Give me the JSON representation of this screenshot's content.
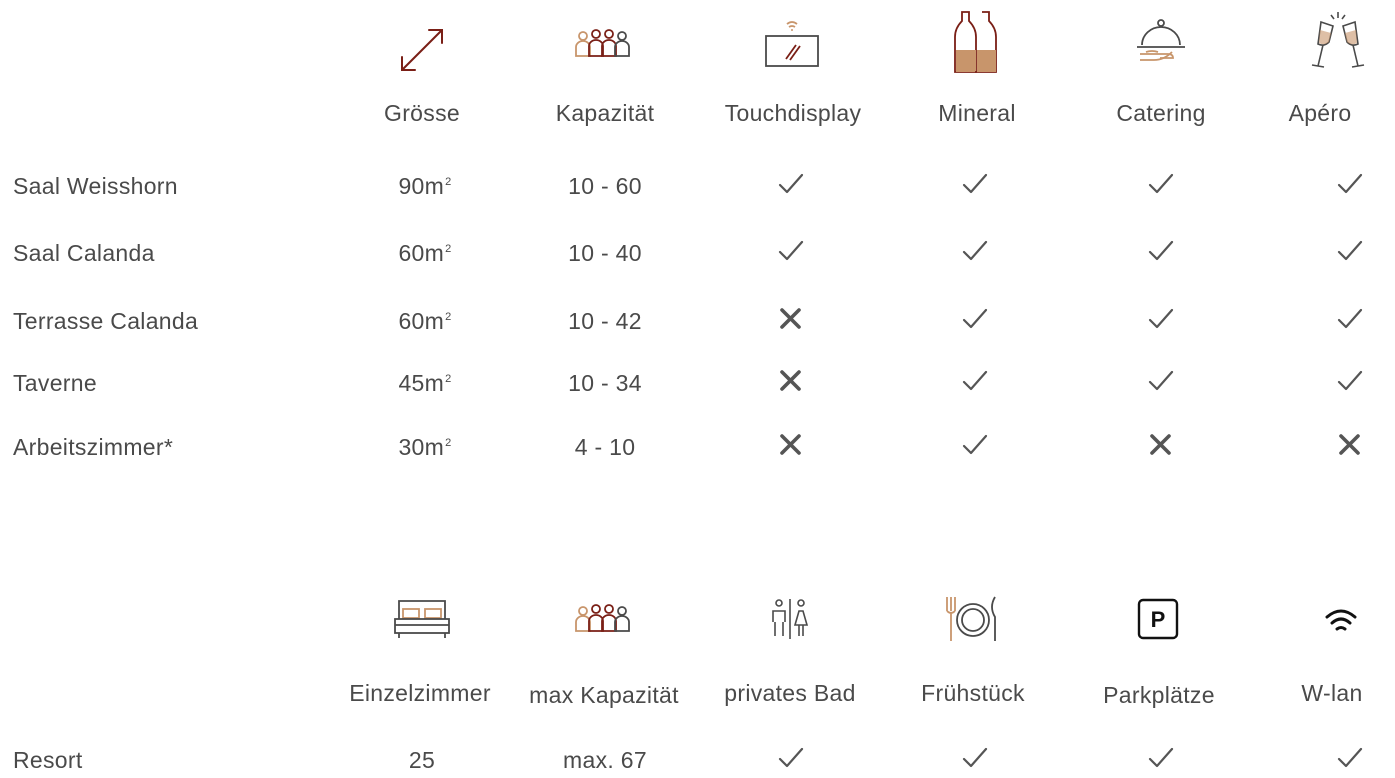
{
  "colors": {
    "text": "#4a4a4a",
    "brown": "#7a1f16",
    "tan": "#c8956b",
    "check": "#555555"
  },
  "rooms_table": {
    "headers": [
      {
        "label": "Grösse",
        "icon": "resize-diagonal-icon"
      },
      {
        "label": "Kapazität",
        "icon": "people-group-icon"
      },
      {
        "label": "Touchdisplay",
        "icon": "touch-display-icon"
      },
      {
        "label": "Mineral",
        "icon": "mineral-bottles-icon"
      },
      {
        "label": "Catering",
        "icon": "catering-cloche-icon"
      },
      {
        "label": "Apéro",
        "icon": "champagne-glasses-icon"
      }
    ],
    "rows": [
      {
        "name": "Saal Weisshorn",
        "size": "90m",
        "size_sup": "2",
        "capacity": "10 - 60",
        "touchdisplay": true,
        "mineral": true,
        "catering": true,
        "apero": true
      },
      {
        "name": "Saal Calanda",
        "size": "60m",
        "size_sup": "2",
        "capacity": "10 - 40",
        "touchdisplay": true,
        "mineral": true,
        "catering": true,
        "apero": true
      },
      {
        "name": "Terrasse Calanda",
        "size": "60m",
        "size_sup": "2",
        "capacity": "10 - 42",
        "touchdisplay": false,
        "mineral": true,
        "catering": true,
        "apero": true
      },
      {
        "name": "Taverne",
        "size": "45m",
        "size_sup": "2",
        "capacity": "10 - 34",
        "touchdisplay": false,
        "mineral": true,
        "catering": true,
        "apero": true
      },
      {
        "name": "Arbeitszimmer*",
        "size": "30m",
        "size_sup": "2",
        "capacity": "4 - 10",
        "touchdisplay": false,
        "mineral": true,
        "catering": false,
        "apero": false
      }
    ]
  },
  "resort_table": {
    "headers": [
      {
        "label": "Einzelzimmer",
        "icon": "bed-icon"
      },
      {
        "label": "max Kapazität",
        "icon": "people-group-icon"
      },
      {
        "label": "privates Bad",
        "icon": "restroom-icon"
      },
      {
        "label": "Frühstück",
        "icon": "plate-cutlery-icon"
      },
      {
        "label": "Parkplätze",
        "icon": "parking-icon"
      },
      {
        "label": "W-lan",
        "icon": "wifi-icon"
      }
    ],
    "rows": [
      {
        "name": "Resort",
        "rooms": "25",
        "capacity": "max. 67",
        "bath": true,
        "breakfast": true,
        "parking": true,
        "wifi": true
      }
    ]
  }
}
